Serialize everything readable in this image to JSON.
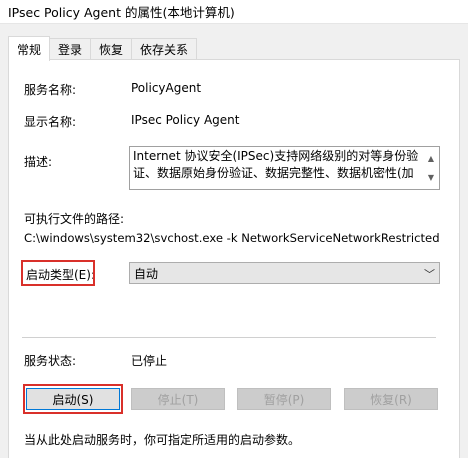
{
  "window": {
    "title": "IPsec Policy Agent 的属性(本地计算机)"
  },
  "tabs": [
    {
      "label": "常规",
      "active": true
    },
    {
      "label": "登录",
      "active": false
    },
    {
      "label": "恢复",
      "active": false
    },
    {
      "label": "依存关系",
      "active": false
    }
  ],
  "general": {
    "service_name_label": "服务名称:",
    "service_name_value": "PolicyAgent",
    "display_name_label": "显示名称:",
    "display_name_value": "IPsec Policy Agent",
    "description_label": "描述:",
    "description_value": "Internet 协议安全(IPSec)支持网络级别的对等身份验证、数据原始身份验证、数据完整性、数据机密性(加",
    "exe_path_label": "可执行文件的路径:",
    "exe_path_value": "C:\\windows\\system32\\svchost.exe -k NetworkServiceNetworkRestricted",
    "startup_type_label": "启动类型(E):",
    "startup_type_value": "自动",
    "service_status_label": "服务状态:",
    "service_status_value": "已停止",
    "hint_text": "当从此处启动服务时，你可指定所适用的启动参数。"
  },
  "buttons": {
    "start": "启动(S)",
    "stop": "停止(T)",
    "pause": "暂停(P)",
    "resume": "恢复(R)"
  },
  "colors": {
    "highlight": "#d9302a",
    "window_bg": "#f0f0f0",
    "panel_bg": "#ffffff"
  }
}
